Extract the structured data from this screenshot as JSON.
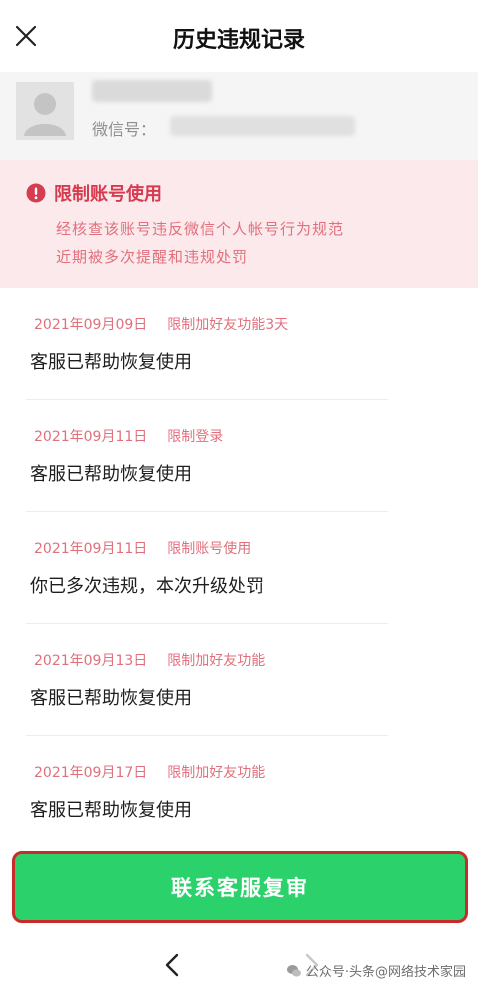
{
  "header": {
    "title": "历史违规记录"
  },
  "user": {
    "wechat_label": "微信号："
  },
  "alert": {
    "title": "限制账号使用",
    "line1": "经核查该账号违反微信个人帐号行为规范",
    "line2": "近期被多次提醒和违规处罚"
  },
  "records": [
    {
      "date": "2021年09月09日",
      "reason": "限制加好友功能3天",
      "desc": "客服已帮助恢复使用"
    },
    {
      "date": "2021年09月11日",
      "reason": "限制登录",
      "desc": "客服已帮助恢复使用"
    },
    {
      "date": "2021年09月11日",
      "reason": "限制账号使用",
      "desc": "你已多次违规，本次升级处罚"
    },
    {
      "date": "2021年09月13日",
      "reason": "限制加好友功能",
      "desc": "客服已帮助恢复使用"
    },
    {
      "date": "2021年09月17日",
      "reason": "限制加好友功能",
      "desc": "客服已帮助恢复使用"
    }
  ],
  "action": {
    "review_label": "联系客服复审"
  },
  "watermark": {
    "text": "公众号·头条@网络技术家园"
  },
  "colors": {
    "accent_green": "#2bd16b",
    "alert_red": "#d63c4f",
    "alert_bg": "#fce9ec",
    "highlight_border": "#c92b2b"
  },
  "icons": {
    "close": "close-icon",
    "alert": "exclamation-circle-icon",
    "avatar": "user-silhouette-icon",
    "back": "chevron-left-icon",
    "forward": "chevron-right-icon"
  }
}
